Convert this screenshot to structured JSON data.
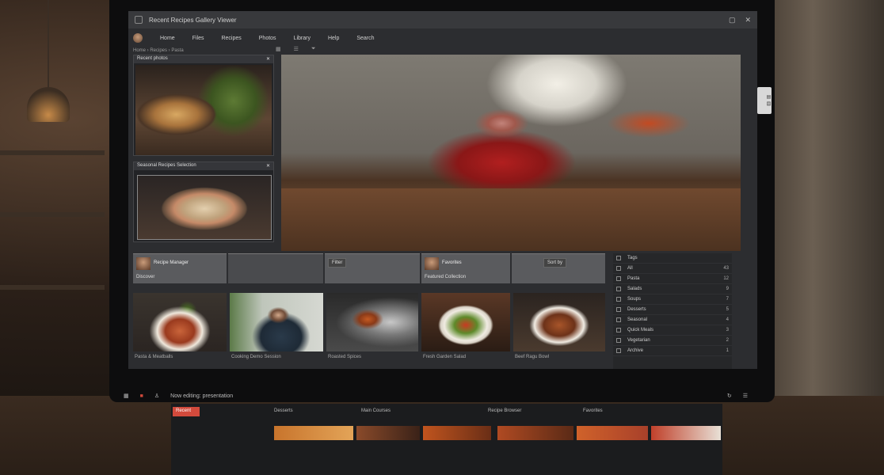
{
  "window": {
    "title": "Recent Recipes Gallery Viewer"
  },
  "menu": {
    "items": [
      "Home",
      "Files",
      "Recipes",
      "Photos",
      "Library",
      "Help",
      "Search"
    ]
  },
  "toolbar": {
    "breadcrumb": "Home › Recipes › Pasta"
  },
  "left_panels": {
    "top_title": "Recent photos",
    "bottom_title": "Seasonal Recipes Selection"
  },
  "strip": {
    "item1_label": "Recipe Manager",
    "item1_sub": "Discover",
    "item2_btn": "Filter",
    "item3_label": "Favorites",
    "item3_sub": "Featured Collection",
    "item4_btn": "Sort by"
  },
  "thumbs": [
    {
      "caption": "Pasta & Meatballs"
    },
    {
      "caption": "Cooking Demo Session"
    },
    {
      "caption": "Roasted Spices"
    },
    {
      "caption": "Fresh Garden Salad"
    },
    {
      "caption": "Beef Ragu Bowl"
    }
  ],
  "right_list": [
    {
      "label": "Tags",
      "val": ""
    },
    {
      "label": "All",
      "val": "43"
    },
    {
      "label": "Pasta",
      "val": "12"
    },
    {
      "label": "Salads",
      "val": "9"
    },
    {
      "label": "Soups",
      "val": "7"
    },
    {
      "label": "Desserts",
      "val": "5"
    },
    {
      "label": "Seasonal",
      "val": "4"
    },
    {
      "label": "Quick Meals",
      "val": "3"
    },
    {
      "label": "Vegetarian",
      "val": "2"
    },
    {
      "label": "Archive",
      "val": "1"
    }
  ],
  "bottom_bar": {
    "status": "Now editing: presentation"
  },
  "lower_screen": {
    "tab": "Recent",
    "sections": [
      "Desserts",
      "Main Courses",
      "Recipe Browser",
      "Favorites"
    ]
  },
  "colors": {
    "accent_red": "#d24a3c",
    "panel_bg": "#2c2d30"
  }
}
